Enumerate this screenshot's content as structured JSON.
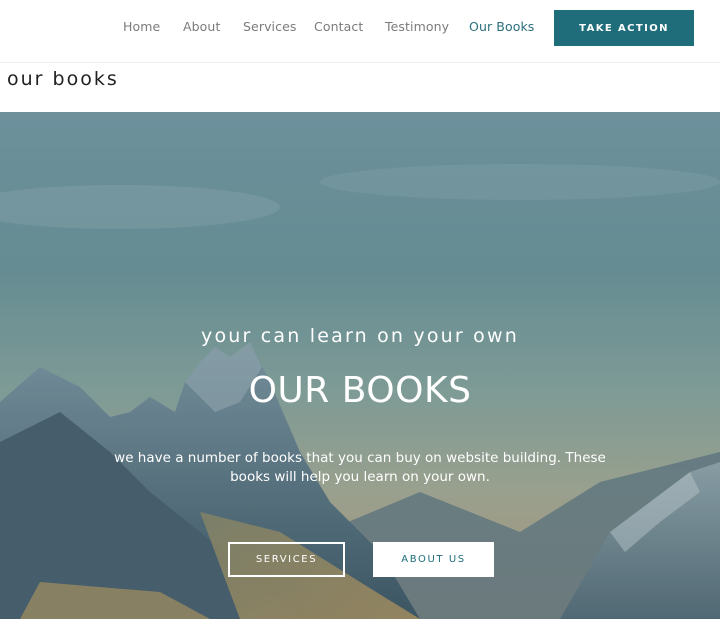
{
  "nav": {
    "items": [
      {
        "label": "Home",
        "active": false
      },
      {
        "label": "About",
        "active": false
      },
      {
        "label": "Services",
        "active": false
      },
      {
        "label": "Contact",
        "active": false
      },
      {
        "label": "Testimony",
        "active": false
      },
      {
        "label": "Our Books",
        "active": true
      }
    ],
    "cta_label": "TAKE ACTION"
  },
  "page": {
    "title": "our books"
  },
  "hero": {
    "subtitle": "your can learn on your own",
    "title": "OUR BOOKS",
    "description": "we have a number of books that you can buy on website building. These books will help you learn on your own.",
    "buttons": {
      "services_label": "SERVICES",
      "about_label": "ABOUT US"
    }
  },
  "colors": {
    "accent": "#1f6d7b",
    "nav_active": "#2a6f7d",
    "nav_text": "#7b7b7b"
  }
}
